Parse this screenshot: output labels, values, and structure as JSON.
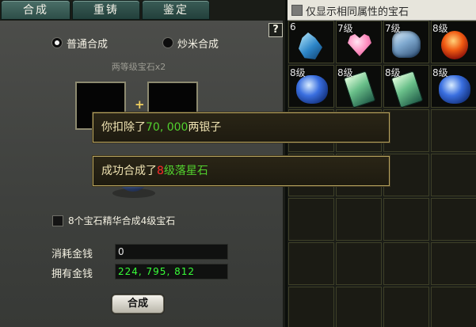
{
  "tabs": [
    {
      "label": "合成",
      "active": true
    },
    {
      "label": "重铸",
      "active": false
    },
    {
      "label": "鉴定",
      "active": false
    }
  ],
  "help_label": "?",
  "mode": {
    "normal_label": "普通合成",
    "special_label": "炒米合成",
    "selected": "normal"
  },
  "hint": "两等级宝石x2",
  "essence_option": {
    "label": "8个宝石精华合成4级宝石",
    "checked": false
  },
  "cost": {
    "label": "消耗金钱",
    "value": "0"
  },
  "owned": {
    "label": "拥有金钱",
    "value": "224, 795, 812"
  },
  "combine_button": "合成",
  "filter": {
    "label": "仅显示相同属性的宝石",
    "checked": false
  },
  "inventory": [
    {
      "level": "6",
      "gem": "blue-crystal-icon"
    },
    {
      "level": "7级",
      "gem": "pink-heart-gem-icon"
    },
    {
      "level": "7级",
      "gem": "ice-stone-icon"
    },
    {
      "level": "8级",
      "gem": "red-gem-icon"
    },
    {
      "level": "8级",
      "gem": "sapphire-icon"
    },
    {
      "level": "8级",
      "gem": "jade-tablet-icon"
    },
    {
      "level": "8级",
      "gem": "jade-tablet-icon"
    },
    {
      "level": "8级",
      "gem": "sapphire-icon"
    }
  ],
  "notices": {
    "deduct": {
      "prefix": "你扣除了",
      "amount": "70, 000",
      "suffix": "两银子"
    },
    "success": {
      "prefix": "成功合成了",
      "level": "8",
      "mid": "级",
      "item": "落星石"
    }
  },
  "colors": {
    "money_green": "#38ff38",
    "notice_border": "#b8a45e",
    "tab_teal": "#2d4e48"
  }
}
